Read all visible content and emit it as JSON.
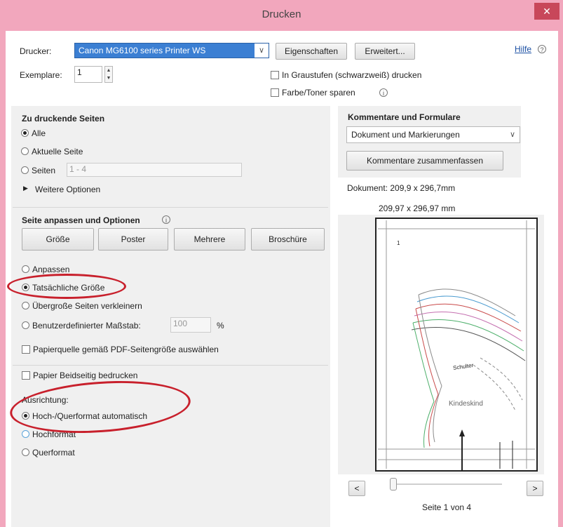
{
  "window": {
    "title": "Drucken",
    "close_symbol": "✕"
  },
  "header": {
    "printer_label": "Drucker:",
    "printer_value": "Canon MG6100 series Printer WS",
    "properties_button": "Eigenschaften",
    "advanced_button": "Erweitert...",
    "help_link": "Hilfe",
    "copies_label": "Exemplare:",
    "copies_value": "1",
    "grayscale_label": "In Graustufen (schwarzweiß) drucken",
    "save_toner_label": "Farbe/Toner sparen"
  },
  "pages_to_print": {
    "heading": "Zu druckende Seiten",
    "option_all": "Alle",
    "option_current": "Aktuelle Seite",
    "option_pages": "Seiten",
    "pages_value": "1 - 4",
    "more_options": "Weitere Optionen"
  },
  "sizing": {
    "heading": "Seite anpassen und Optionen",
    "button_size": "Größe",
    "button_poster": "Poster",
    "button_multiple": "Mehrere",
    "button_booklet": "Broschüre",
    "option_fit": "Anpassen",
    "option_actual": "Tatsächliche Größe",
    "option_shrink": "Übergroße Seiten verkleinern",
    "option_custom": "Benutzerdefinierter Maßstab:",
    "custom_value": "100",
    "percent": "%",
    "paper_source": "Papierquelle gemäß PDF-Seitengröße auswählen"
  },
  "duplex": {
    "label": "Papier Beidseitig bedrucken"
  },
  "orientation": {
    "heading": "Ausrichtung:",
    "option_auto": "Hoch-/Querformat automatisch",
    "option_portrait": "Hochformat",
    "option_landscape": "Querformat"
  },
  "comments": {
    "heading": "Kommentare und Formulare",
    "select_value": "Dokument und Markierungen",
    "summarize_button": "Kommentare zusammenfassen"
  },
  "preview": {
    "doc_size": "Dokument: 209,9 x 296,7mm",
    "page_size": "209,97 x 296,97 mm",
    "prev_button": "<",
    "next_button": ">",
    "page_indicator": "Seite 1 von 4",
    "page_number_mark": "1",
    "pattern_label": "Schulter",
    "brand_label": "Kindeskind"
  }
}
